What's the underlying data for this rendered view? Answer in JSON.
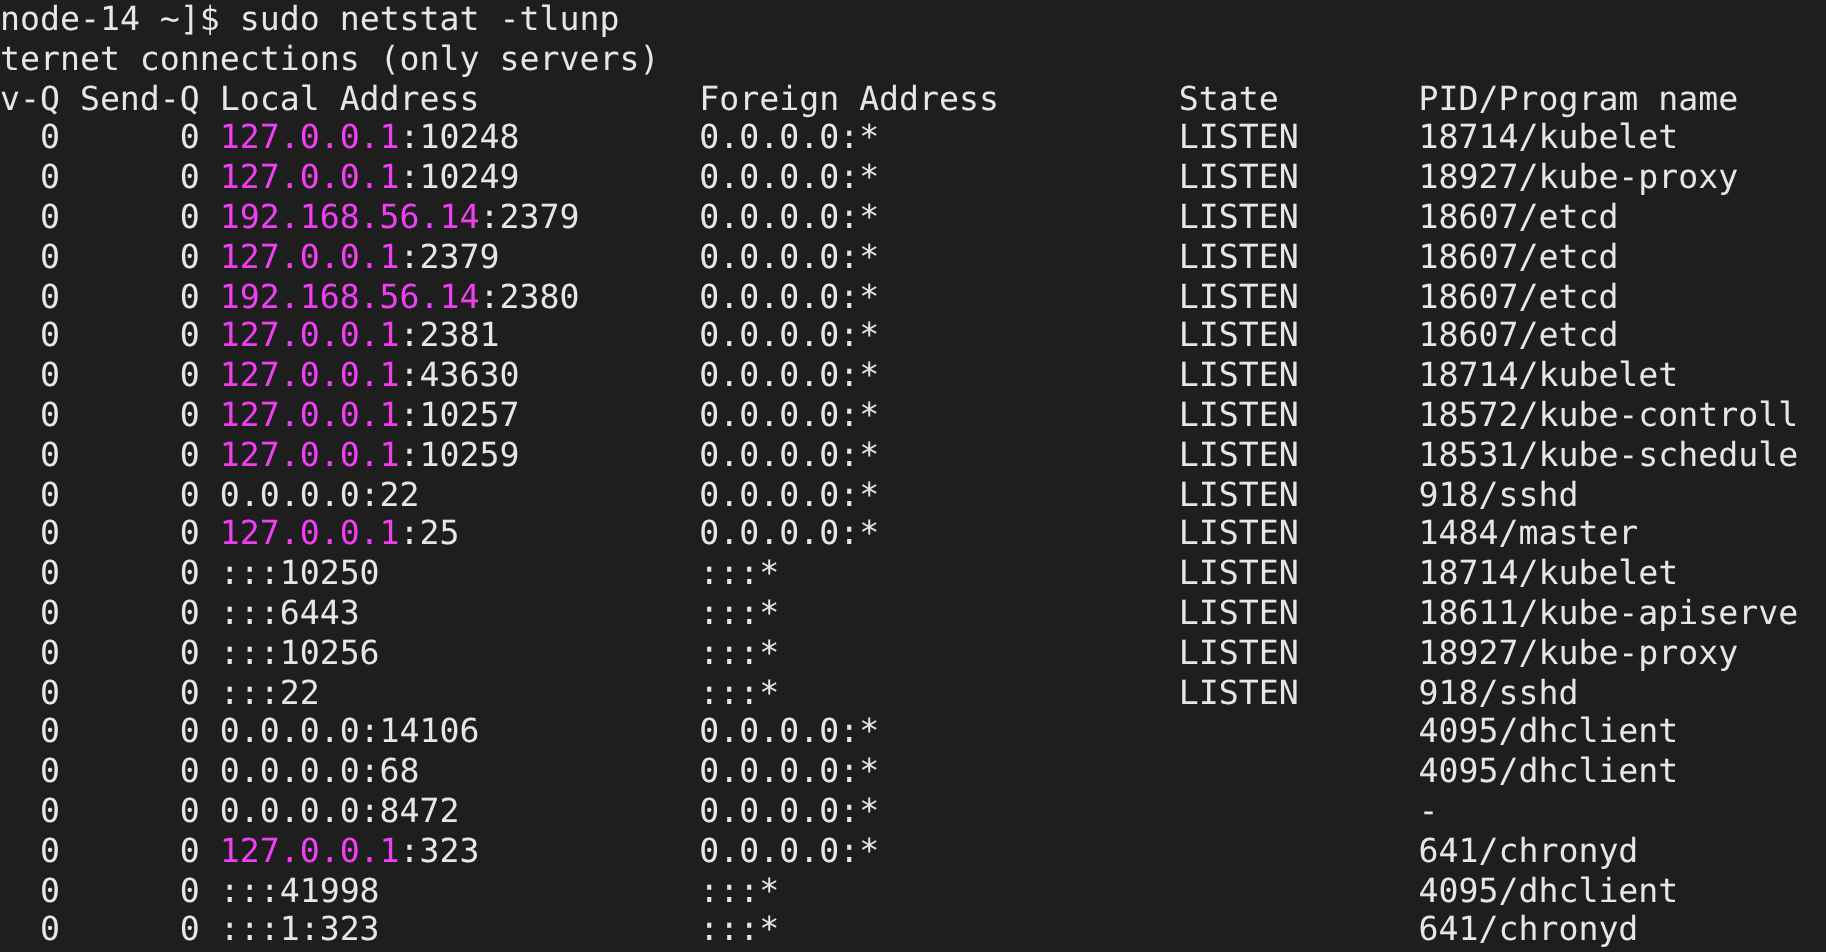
{
  "prompt": "node-14 ~]$ sudo netstat -tlunp",
  "title": "ternet connections (only servers)",
  "columns": [
    "v-Q",
    "Send-Q",
    "Local Address",
    "Foreign Address",
    "State",
    "PID/Program name"
  ],
  "rows": [
    {
      "recv_q": "0",
      "send_q": "0",
      "local_ip": "127.0.0.1",
      "highlighted": true,
      "local_port": ":10248",
      "foreign": "0.0.0.0:*",
      "state": "LISTEN",
      "program": "18714/kubelet"
    },
    {
      "recv_q": "0",
      "send_q": "0",
      "local_ip": "127.0.0.1",
      "highlighted": true,
      "local_port": ":10249",
      "foreign": "0.0.0.0:*",
      "state": "LISTEN",
      "program": "18927/kube-proxy"
    },
    {
      "recv_q": "0",
      "send_q": "0",
      "local_ip": "192.168.56.14",
      "highlighted": true,
      "local_port": ":2379",
      "foreign": "0.0.0.0:*",
      "state": "LISTEN",
      "program": "18607/etcd"
    },
    {
      "recv_q": "0",
      "send_q": "0",
      "local_ip": "127.0.0.1",
      "highlighted": true,
      "local_port": ":2379",
      "foreign": "0.0.0.0:*",
      "state": "LISTEN",
      "program": "18607/etcd"
    },
    {
      "recv_q": "0",
      "send_q": "0",
      "local_ip": "192.168.56.14",
      "highlighted": true,
      "local_port": ":2380",
      "foreign": "0.0.0.0:*",
      "state": "LISTEN",
      "program": "18607/etcd"
    },
    {
      "recv_q": "0",
      "send_q": "0",
      "local_ip": "127.0.0.1",
      "highlighted": true,
      "local_port": ":2381",
      "foreign": "0.0.0.0:*",
      "state": "LISTEN",
      "program": "18607/etcd"
    },
    {
      "recv_q": "0",
      "send_q": "0",
      "local_ip": "127.0.0.1",
      "highlighted": true,
      "local_port": ":43630",
      "foreign": "0.0.0.0:*",
      "state": "LISTEN",
      "program": "18714/kubelet"
    },
    {
      "recv_q": "0",
      "send_q": "0",
      "local_ip": "127.0.0.1",
      "highlighted": true,
      "local_port": ":10257",
      "foreign": "0.0.0.0:*",
      "state": "LISTEN",
      "program": "18572/kube-controll"
    },
    {
      "recv_q": "0",
      "send_q": "0",
      "local_ip": "127.0.0.1",
      "highlighted": true,
      "local_port": ":10259",
      "foreign": "0.0.0.0:*",
      "state": "LISTEN",
      "program": "18531/kube-schedule"
    },
    {
      "recv_q": "0",
      "send_q": "0",
      "local_ip": "0.0.0.0",
      "highlighted": false,
      "local_port": ":22",
      "foreign": "0.0.0.0:*",
      "state": "LISTEN",
      "program": "918/sshd"
    },
    {
      "recv_q": "0",
      "send_q": "0",
      "local_ip": "127.0.0.1",
      "highlighted": true,
      "local_port": ":25",
      "foreign": "0.0.0.0:*",
      "state": "LISTEN",
      "program": "1484/master"
    },
    {
      "recv_q": "0",
      "send_q": "0",
      "local_ip": "::",
      "highlighted": false,
      "local_port": ":10250",
      "foreign": ":::*",
      "state": "LISTEN",
      "program": "18714/kubelet"
    },
    {
      "recv_q": "0",
      "send_q": "0",
      "local_ip": "::",
      "highlighted": false,
      "local_port": ":6443",
      "foreign": ":::*",
      "state": "LISTEN",
      "program": "18611/kube-apiserve"
    },
    {
      "recv_q": "0",
      "send_q": "0",
      "local_ip": "::",
      "highlighted": false,
      "local_port": ":10256",
      "foreign": ":::*",
      "state": "LISTEN",
      "program": "18927/kube-proxy"
    },
    {
      "recv_q": "0",
      "send_q": "0",
      "local_ip": "::",
      "highlighted": false,
      "local_port": ":22",
      "foreign": ":::*",
      "state": "LISTEN",
      "program": "918/sshd"
    },
    {
      "recv_q": "0",
      "send_q": "0",
      "local_ip": "0.0.0.0",
      "highlighted": false,
      "local_port": ":14106",
      "foreign": "0.0.0.0:*",
      "program": "4095/dhclient"
    },
    {
      "recv_q": "0",
      "send_q": "0",
      "local_ip": "0.0.0.0",
      "highlighted": false,
      "local_port": ":68",
      "foreign": "0.0.0.0:*",
      "program": "4095/dhclient"
    },
    {
      "recv_q": "0",
      "send_q": "0",
      "local_ip": "0.0.0.0",
      "highlighted": false,
      "local_port": ":8472",
      "foreign": "0.0.0.0:*",
      "program": "-"
    },
    {
      "recv_q": "0",
      "send_q": "0",
      "local_ip": "127.0.0.1",
      "highlighted": true,
      "local_port": ":323",
      "foreign": "0.0.0.0:*",
      "program": "641/chronyd"
    },
    {
      "recv_q": "0",
      "send_q": "0",
      "local_ip": "::",
      "highlighted": false,
      "local_port": ":41998",
      "foreign": ":::*",
      "program": "4095/dhclient"
    },
    {
      "recv_q": "0",
      "send_q": "0",
      "local_ip": "::",
      "highlighted": false,
      "local_port": ":1:323",
      "foreign": ":::*",
      "program": "641/chronyd"
    }
  ]
}
